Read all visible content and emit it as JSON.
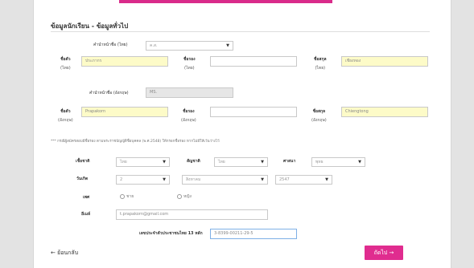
{
  "page": {
    "title": "ข้อมูลนักเรียน - ข้อมูลทั่วไป"
  },
  "thai": {
    "prefix_label": "คำนำหน้าชื่อ (ไทย)",
    "prefix_value": "ค.ส.",
    "first_name_label": "ชื่อตัว",
    "first_name_sub": "(ไทย)",
    "first_name_value": "ประภากร",
    "middle_name_label": "ชื่อรอง",
    "middle_name_sub": "(ไทย)",
    "middle_name_value": "",
    "last_name_label": "ชื่อสกุล",
    "last_name_sub": "(ไทย)",
    "last_name_value": "เชียงทอง"
  },
  "english": {
    "prefix_label": "คำนำหน้าชื่อ (อังกฤษ)",
    "prefix_value": "MS.",
    "first_name_label": "ชื่อตัว",
    "first_name_sub": "(อังกฤษ)",
    "first_name_value": "Prapakorn",
    "middle_name_label": "ชื่อรอง",
    "middle_name_sub": "(อังกฤษ)",
    "middle_name_value": "",
    "last_name_label": "ชื่อสกุล",
    "last_name_sub": "(อังกฤษ)",
    "last_name_value": "Chiengtong"
  },
  "note": "*** กรณีผู้สมัครสอบมีชื่อรอง ตามพระราชบัญญัติชื่อบุคคล (พ.ศ.2548) ให้กรอกชื่อรอง หากไม่มีให้เว้นว่างไว้",
  "details": {
    "race_label": "เชื้อชาติ",
    "race_value": "ไทย",
    "nationality_label": "สัญชาติ",
    "nationality_value": "ไทย",
    "religion_label": "ศาสนา",
    "religion_value": "พุทธ",
    "birthdate_label": "วันเกิด",
    "day_value": "2",
    "month_value": "สิงหาคม",
    "year_value": "2547",
    "gender_label": "เพศ",
    "gender_male": "ชาย",
    "gender_female": "หญิง",
    "email_label": "อีเมล์",
    "email_value": "t.prapakorn@gmail.com",
    "id_label": "เลขประจำตัวประชาชนไทย 13 หลัก",
    "id_value": "3-8399-00211-29-5"
  },
  "nav": {
    "back_label": "← ย้อนกลับ",
    "next_label": "ถัดไป →"
  },
  "colors": {
    "accent": "#d92b8a",
    "button": "#e02c8f",
    "highlight_field": "#fdfbc8"
  }
}
